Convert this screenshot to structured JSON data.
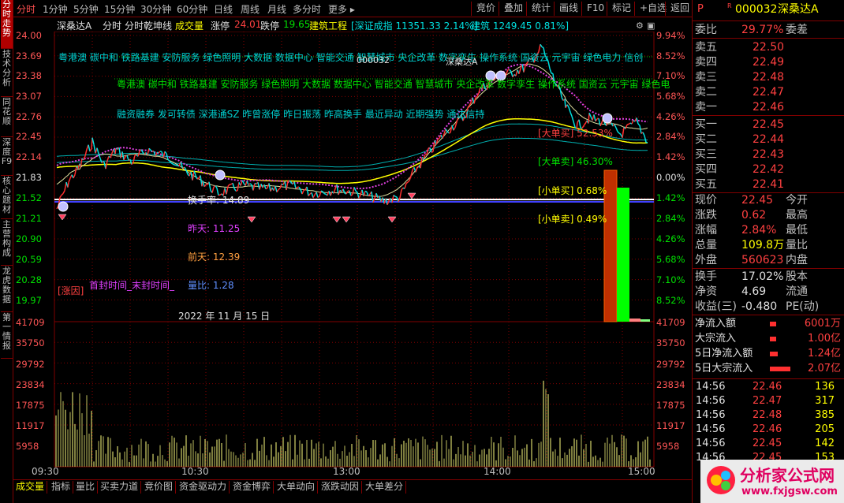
{
  "left_tabs": [
    "分时走势",
    "技术分析",
    "同花顺",
    "深度F9",
    "核心题材",
    "主营构成",
    "龙虎数据",
    "第一情报"
  ],
  "top_menu": [
    "分时",
    "1分钟",
    "5分钟",
    "15分钟",
    "30分钟",
    "60分钟",
    "日线",
    "周线",
    "月线",
    "多分时",
    "更多"
  ],
  "top_buttons": [
    "竞价",
    "叠加",
    "统计",
    "画线",
    "F10",
    "标记",
    "+自选",
    "返回"
  ],
  "info": {
    "name": "深桑达A",
    "mode1": "分时",
    "mode2": "分时乾坤线",
    "vol_label": "成交量",
    "limit_up_label": "涨停",
    "limit_up_val": "24.01",
    "limit_down_label": "跌停",
    "limit_down_val": "19.65",
    "sector": "建筑工程",
    "index1": "[深证成指 11351.33 2.14%]",
    "index2": "建筑 1249.45 0.81%]"
  },
  "price_axis": [
    "24.00",
    "23.69",
    "23.38",
    "23.07",
    "22.76",
    "22.45",
    "22.14",
    "21.83",
    "21.52",
    "21.21",
    "20.90",
    "20.59",
    "20.28",
    "19.97"
  ],
  "pct_axis": [
    "9.94%",
    "8.52%",
    "7.10%",
    "5.68%",
    "4.26%",
    "2.84%",
    "1.42%",
    "0.00%",
    "1.42%",
    "2.84%",
    "4.26%",
    "5.68%",
    "7.10%",
    "8.52%"
  ],
  "vol_axis_left": [
    "41709",
    "35750",
    "29792",
    "23834",
    "17875",
    "11917",
    "5958"
  ],
  "vol_axis_right": [
    "41709",
    "35750",
    "29792",
    "23834",
    "17875",
    "11917",
    "5958"
  ],
  "time_axis": [
    "09:30",
    "10:30",
    "13:00",
    "14:00",
    "15:00"
  ],
  "concepts_row1": "粤港澳  碳中和  铁路基建  安防服务  绿色照明  大数据  数据中心  智能交通  智慧城市  央企改革  数字孪生  操作系统  国资云  元宇宙  绿色电力  信创",
  "concepts_row2": "粤港澳  碳中和  铁路基建  安防服务  绿色照明  大数据  数据中心  智能交通  智慧城市  央企改革  数字孪生  操作系统  国资云  元宇宙  绿色电",
  "concepts_row3": "融资融券  发可转债  深港通SZ  昨曾涨停  昨日振荡  昨高换手  最近异动  近期强势  通达信持",
  "code_label1": "000032",
  "code_label2": "深桑达A",
  "annot": {
    "turnover": "换手率: 14.89",
    "yesterday": "昨天: 11.25",
    "daybefore": "前天: 12.39",
    "limit_reason": "[涨因]",
    "seal_time": "首封时间_末封时间_",
    "ratio": "量比: 1.28",
    "date": "2022 年 11 月 15 日",
    "big_buy": "[大单买] 52.53%",
    "big_sell": "[大单卖] 46.30%",
    "small_buy": "[小单买] 0.68%",
    "small_sell": "[小单卖] 0.49%",
    "small_label": "万元"
  },
  "bottom_tabs": [
    "成交量",
    "指标",
    "量比",
    "买卖力道",
    "竞价图",
    "资金驱动力",
    "资金博弈",
    "大单动向",
    "涨跌动因",
    "大单差分"
  ],
  "right_panel": {
    "header_tag": "P",
    "header_mark": "R",
    "code": "000032",
    "name": "深桑达A",
    "weibi_label": "委比",
    "weibi_val": "29.77%",
    "weicha_label": "委差",
    "asks": [
      {
        "label": "卖五",
        "price": "22.50"
      },
      {
        "label": "卖四",
        "price": "22.49"
      },
      {
        "label": "卖三",
        "price": "22.48"
      },
      {
        "label": "卖二",
        "price": "22.47"
      },
      {
        "label": "卖一",
        "price": "22.46"
      }
    ],
    "bids": [
      {
        "label": "买一",
        "price": "22.45"
      },
      {
        "label": "买二",
        "price": "22.44"
      },
      {
        "label": "买三",
        "price": "22.43"
      },
      {
        "label": "买四",
        "price": "22.42"
      },
      {
        "label": "买五",
        "price": "22.41"
      }
    ],
    "stats": [
      {
        "l1": "现价",
        "v1": "22.45",
        "l2": "今开",
        "c": "red"
      },
      {
        "l1": "涨跌",
        "v1": "0.62",
        "l2": "最高",
        "c": "red"
      },
      {
        "l1": "涨幅",
        "v1": "2.84%",
        "l2": "最低",
        "c": "red"
      },
      {
        "l1": "总量",
        "v1": "109.8万",
        "l2": "量比",
        "c": "yel"
      },
      {
        "l1": "外盘",
        "v1": "560623",
        "l2": "内盘",
        "c": "red"
      }
    ],
    "stats2": [
      {
        "l1": "换手",
        "v1": "17.02%",
        "l2": "股本",
        "c": "wht"
      },
      {
        "l1": "净资",
        "v1": "4.69",
        "l2": "流通",
        "c": "wht"
      },
      {
        "l1": "收益(三)",
        "v1": "-0.480",
        "l2": "PE(动)",
        "c": "wht"
      }
    ],
    "flows": [
      {
        "label": "净流入额",
        "val": "6001万",
        "w": 8
      },
      {
        "label": "大宗流入",
        "val": "1.00亿",
        "w": 8
      },
      {
        "label": "5日净流入额",
        "val": "1.24亿",
        "w": 10
      },
      {
        "label": "5日大宗流入",
        "val": "2.07亿",
        "w": 26
      }
    ],
    "ticks": [
      {
        "t": "14:56",
        "p": "22.46",
        "v": "136"
      },
      {
        "t": "14:56",
        "p": "22.47",
        "v": "317"
      },
      {
        "t": "14:56",
        "p": "22.48",
        "v": "385"
      },
      {
        "t": "14:56",
        "p": "22.46",
        "v": "205"
      },
      {
        "t": "14:56",
        "p": "22.45",
        "v": "142"
      },
      {
        "t": "14:56",
        "p": "22.45",
        "v": "153"
      }
    ]
  },
  "logo": {
    "title": "分析家公式网",
    "url": "www.fxjgsw.com"
  },
  "colors": {
    "bg": "#000000",
    "border": "#800000",
    "up": "#ff4040",
    "down": "#00e000",
    "price_line": "#ffffff",
    "avg_line": "#ffff00"
  }
}
